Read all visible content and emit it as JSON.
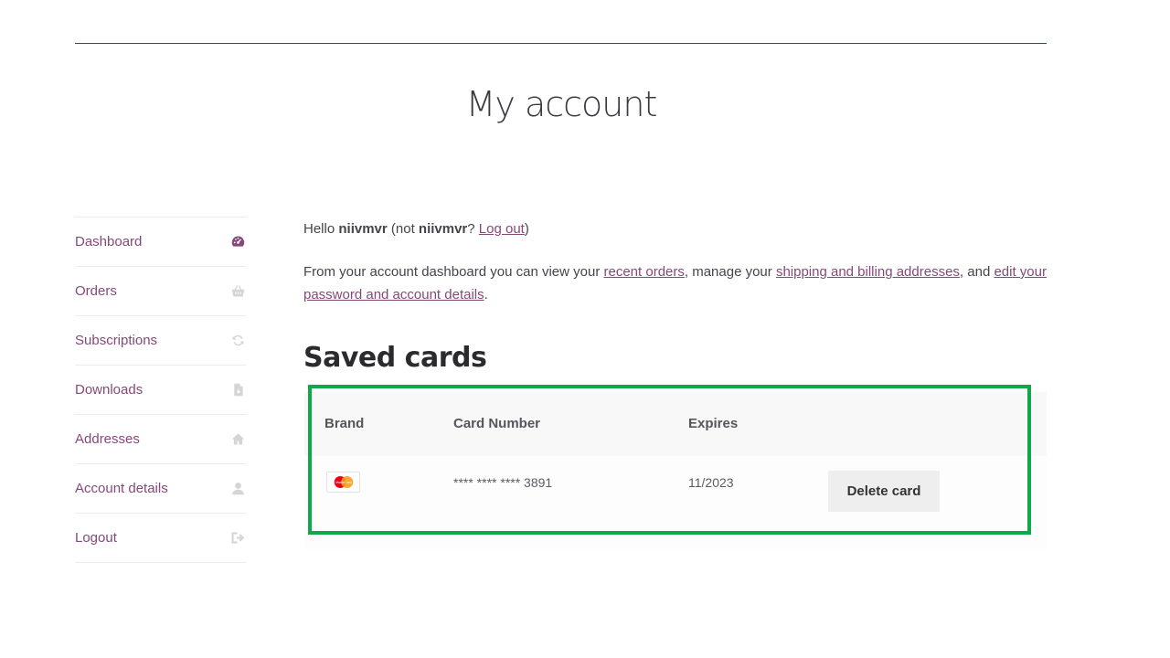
{
  "page": {
    "title": "My account"
  },
  "nav": {
    "items": [
      {
        "label": "Dashboard",
        "icon": "dashboard-icon"
      },
      {
        "label": "Orders",
        "icon": "basket-icon"
      },
      {
        "label": "Subscriptions",
        "icon": "refresh-icon"
      },
      {
        "label": "Downloads",
        "icon": "file-icon"
      },
      {
        "label": "Addresses",
        "icon": "home-icon"
      },
      {
        "label": "Account details",
        "icon": "user-icon"
      },
      {
        "label": "Logout",
        "icon": "sign-out-icon"
      }
    ]
  },
  "greeting": {
    "prefix": "Hello ",
    "username": "niivmvr",
    "middle": " (not ",
    "username2": "niivmvr",
    "question": "? ",
    "logout_link": "Log out",
    "suffix": ")"
  },
  "intro": {
    "part1": "From your account dashboard you can view your ",
    "link_orders": "recent orders",
    "part2": ", manage your ",
    "link_addresses": "shipping and billing addresses",
    "part3": ", and ",
    "link_account": "edit your password and account details",
    "part4": "."
  },
  "saved_cards": {
    "heading": "Saved cards",
    "columns": [
      "Brand",
      "Card Number",
      "Expires"
    ],
    "rows": [
      {
        "brand_icon": "mastercard-icon",
        "brand_text": "MasterCard",
        "number": "**** **** **** 3891",
        "expires": "11/2023",
        "action": "Delete card"
      }
    ]
  },
  "colors": {
    "link": "#86487a",
    "highlight": "#10a84a",
    "rule": "#1e5e3e"
  }
}
